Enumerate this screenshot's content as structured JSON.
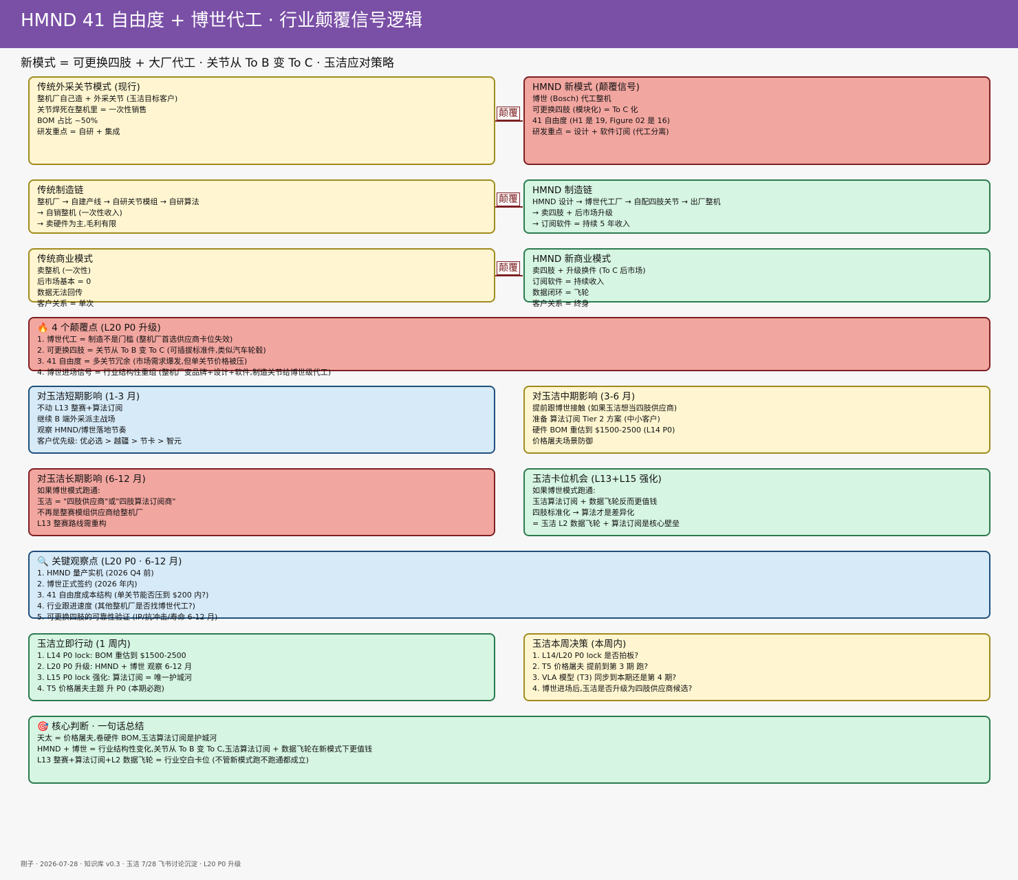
{
  "header": {
    "title": "HMND 41 自由度 + 博世代工 ·  行业颠覆信号逻辑",
    "subtitle": "新模式 = 可更换四肢 + 大厂代工 ·  关节从 To B 变 To C ·  玉洁应对策略"
  },
  "colors": {
    "header": "#7a4fa6",
    "yellow": "#fff6d1",
    "red": "#f2a6a0",
    "green": "#d6f5e3",
    "blue": "#d6eaf8"
  },
  "connector_label": "颠覆",
  "boxes": {
    "trad_joint": {
      "title": "传统外采关节模式 (现行)",
      "lines": [
        "整机厂自己造 + 外采关节 (玉洁目标客户)",
        "关节焊死在整机里 = 一次性销售",
        "BOM 占比 ~50%",
        "研发重点 = 自研 + 集成"
      ]
    },
    "hmnd_model": {
      "title": "HMND 新模式 (颠覆信号)",
      "lines": [
        "博世 (Bosch) 代工整机",
        "可更换四肢 (模块化) = To C 化",
        "41 自由度 (H1 是 19, Figure 02 是 16)",
        "研发重点 = 设计 + 软件订阅 (代工分离)"
      ]
    },
    "trad_chain": {
      "title": "传统制造链",
      "lines": [
        "整机厂 → 自建产线 → 自研关节模组 → 自研算法",
        "→ 自销整机 (一次性收入)",
        "→ 卖硬件为主,毛利有限"
      ]
    },
    "hmnd_chain": {
      "title": "HMND 制造链",
      "lines": [
        "HMND 设计 → 博世代工厂 → 自配四肢关节 → 出厂整机",
        "→ 卖四肢 + 后市场升级",
        "→ 订阅软件 = 持续 5 年收入"
      ]
    },
    "trad_biz": {
      "title": "传统商业模式",
      "lines": [
        "卖整机 (一次性)",
        "后市场基本 = 0",
        "数据无法回传",
        "客户关系 = 单次"
      ]
    },
    "hmnd_biz": {
      "title": "HMND 新商业模式",
      "lines": [
        "卖四肢 + 升级换件 (To C 后市场)",
        "订阅软件 = 持续收入",
        "数据闭环 = 飞轮",
        "客户关系 = 终身"
      ]
    },
    "disrupt": {
      "title": "🔥 4 个颠覆点 (L20 P0 升级)",
      "lines": [
        "1. 博世代工 = 制造不是门槛 (整机厂首选供应商卡位失效)",
        "2. 可更换四肢 = 关节从 To B 变 To C (可插拔标准件,类似汽车轮毂)",
        "3. 41 自由度 = 多关节冗余 (市场需求爆发,但单关节价格被压)",
        "4. 博世进场信号 = 行业结构性重组 (整机厂变品牌+设计+软件,制造关节给博世级代工)"
      ]
    },
    "short": {
      "title": "对玉洁短期影响 (1-3 月)",
      "lines": [
        "不动 L13 整赛+算法订阅",
        "继续 B 端外采派主战场",
        "观察 HMND/博世落地节奏",
        "客户优先级: 优必选 > 越疆 > 节卡 > 智元"
      ]
    },
    "mid": {
      "title": "对玉洁中期影响 (3-6 月)",
      "lines": [
        "提前跟博世接触 (如果玉洁想当四肢供应商)",
        "准备 算法订阅 Tier 2 方案 (中小客户)",
        "硬件 BOM 重估到 $1500-2500 (L14 P0)",
        "价格屠夫场景防御"
      ]
    },
    "long": {
      "title": "对玉洁长期影响 (6-12 月)",
      "lines": [
        "如果博世模式跑通:",
        "玉洁 = \"四肢供应商\"或\"四肢算法订阅商\"",
        "不再是整赛模组供应商给整机厂",
        "L13 整赛路线需重构"
      ]
    },
    "opportunity": {
      "title": "玉洁卡位机会 (L13+L15 强化)",
      "lines": [
        "如果博世模式跑通:",
        "玉洁算法订阅 + 数据飞轮反而更值钱",
        "四肢标准化 → 算法才是差异化",
        "= 玉洁 L2 数据飞轮 + 算法订阅是核心壁垒"
      ]
    },
    "watch": {
      "title": "🔍 关键观察点 (L20 P0 ·  6-12 月)",
      "lines": [
        "1. HMND 量产实机 (2026 Q4 前)",
        "2. 博世正式签约 (2026 年内)",
        "3. 41 自由度成本结构 (单关节能否压到 $200 内?)",
        "4. 行业跟进速度 (其他整机厂是否找博世代工?)",
        "5. 可更换四肢的可靠性验证 (IP/抗冲击/寿命 6-12 月)"
      ]
    },
    "action": {
      "title": "玉洁立即行动 (1 周内)",
      "lines": [
        "1. L14 P0 lock: BOM 重估到 $1500-2500",
        "2. L20 P0 升级: HMND + 博世 观察 6-12 月",
        "3. L15 P0 lock 强化: 算法订阅 = 唯一护城河",
        "4. T5 价格屠夫主题 升 P0 (本期必跑)"
      ]
    },
    "decision": {
      "title": "玉洁本周决策 (本周内)",
      "lines": [
        "1. L14/L20 P0 lock 是否拍板?",
        "2. T5 价格屠夫 提前到第 3 期 跑?",
        "3. VLA 模型 (T3) 同步到本期还是第 4 期?",
        "4. 博世进场后,玉洁是否升级为四肢供应商候选?"
      ]
    },
    "core": {
      "title": "🎯 核心判断 ·  一句话总结",
      "lines": [
        "天太 = 价格屠夫,卷硬件 BOM,玉洁算法订阅是护城河",
        "HMND + 博世 = 行业结构性变化,关节从 To B 变 To C,玉洁算法订阅 + 数据飞轮在新模式下更值钱",
        "L13 整赛+算法订阅+L2 数据飞轮 = 行业空白卡位 (不管新模式跑不跑通都成立)"
      ]
    }
  },
  "footer": "刚子 ·  2026-07-28 ·  知识库 v0.3 ·  玉洁 7/28 飞书讨论沉淀 ·  L20 P0 升级"
}
